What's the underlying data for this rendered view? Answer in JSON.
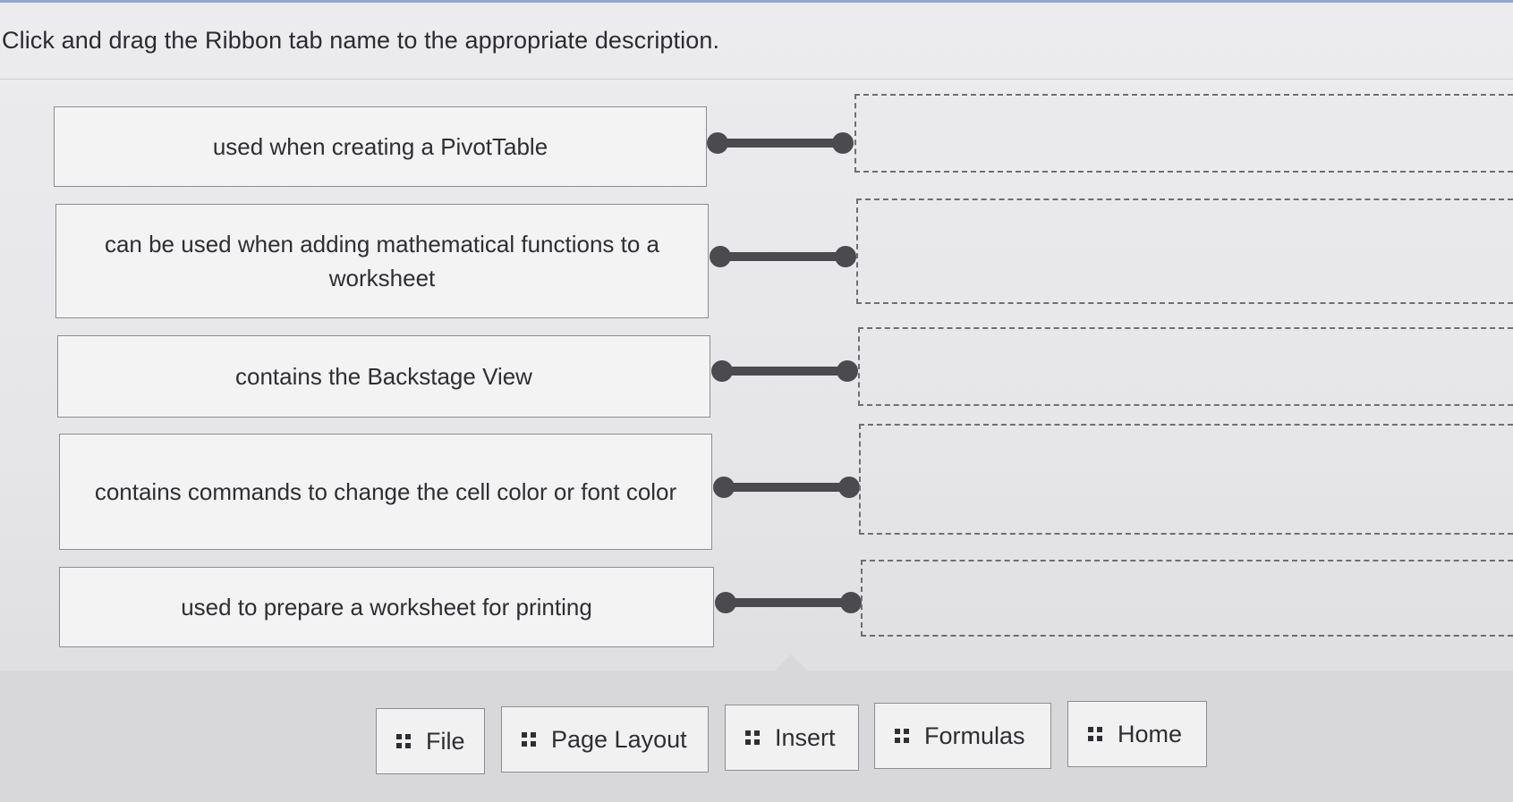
{
  "instruction": "Click and drag the Ribbon tab name to the appropriate description.",
  "descriptions": [
    {
      "text": "used when creating a PivotTable"
    },
    {
      "text": "can be used when adding mathematical functions to a worksheet"
    },
    {
      "text": "contains the Backstage View"
    },
    {
      "text": "contains commands to change the cell color or font color"
    },
    {
      "text": "used to prepare a worksheet for printing"
    }
  ],
  "tab_options": [
    {
      "label": "File",
      "icon": "drag-handle-icon"
    },
    {
      "label": "Page Layout",
      "icon": "drag-handle-icon"
    },
    {
      "label": "Insert",
      "icon": "drag-handle-icon"
    },
    {
      "label": "Formulas",
      "icon": "drag-handle-icon"
    },
    {
      "label": "Home",
      "icon": "drag-handle-icon"
    }
  ],
  "colors": {
    "connector": "#4a4a4f",
    "box_border": "#8d8d92",
    "background": "#e9e9ea"
  }
}
